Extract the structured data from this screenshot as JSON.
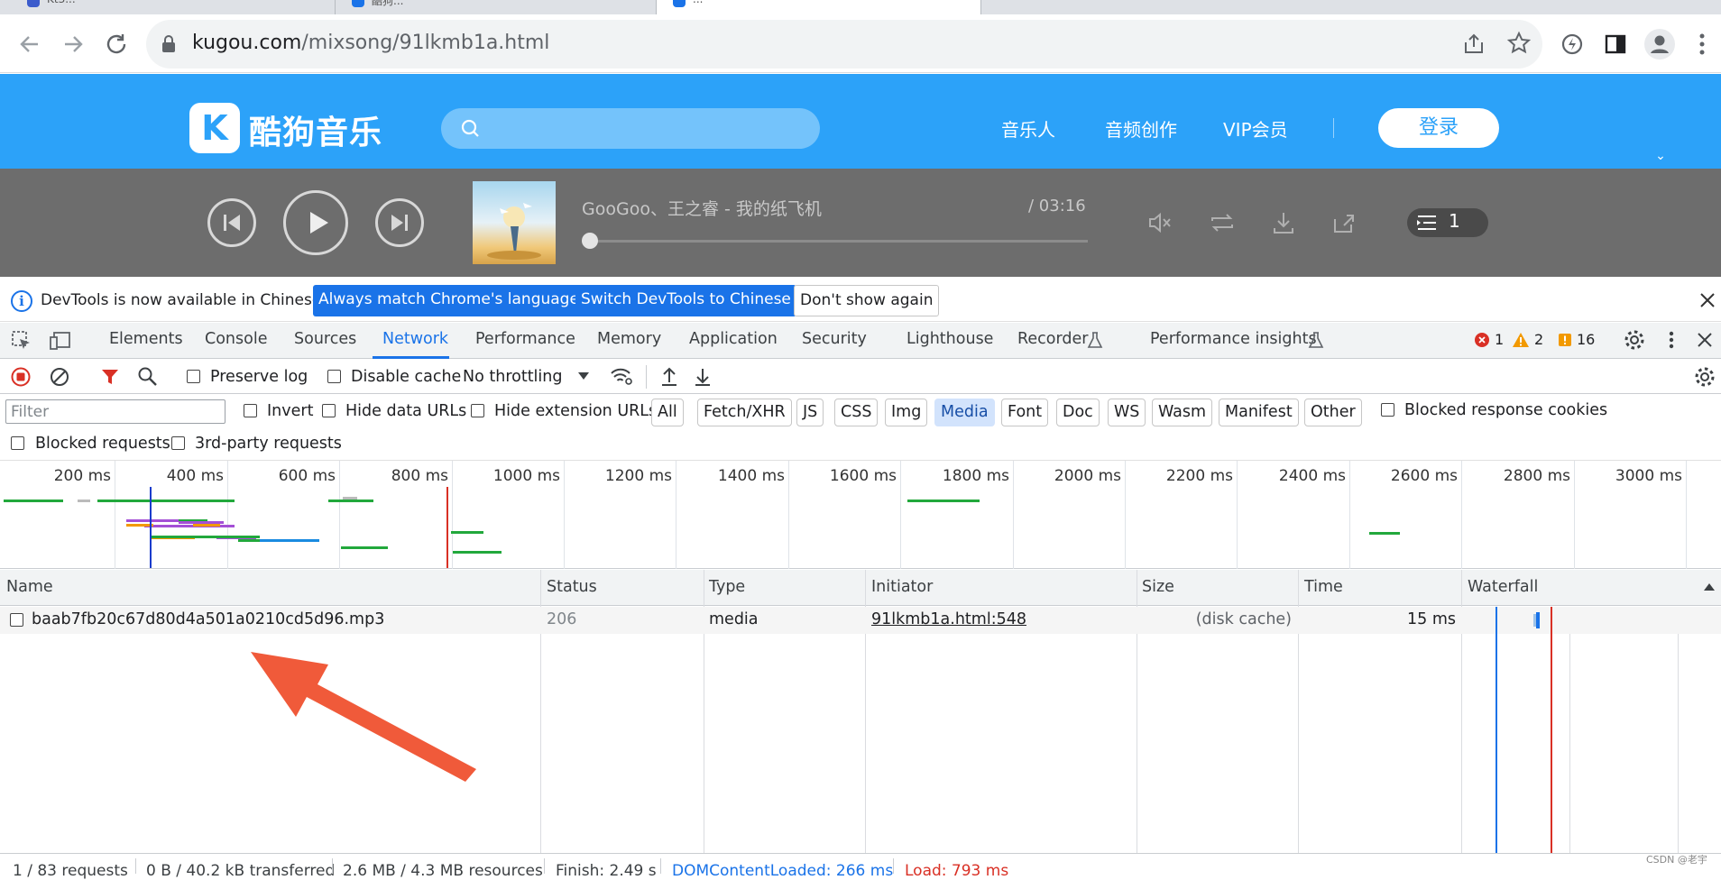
{
  "browser": {
    "tabs": [
      {
        "title": "Kt3...",
        "fav_color": "#3b5bcc"
      },
      {
        "title": "酷狗...",
        "fav_color": "#1a73e8"
      },
      {
        "title": "...",
        "fav_color": "#1a73e8"
      }
    ],
    "url_host": "kugou.com",
    "url_path": "/mixsong/91lkmb1a.html"
  },
  "kugou": {
    "logo_letter": "K",
    "logo_text": "酷狗音乐",
    "nav": [
      "音乐人",
      "音频创作",
      "VIP会员"
    ],
    "login_label": "登录",
    "down_arrow": "⌄"
  },
  "player": {
    "song_title": "GooGoo、王之睿 - 我的纸飞机",
    "time": "/ 03:16",
    "queue_count": "1"
  },
  "infobar": {
    "message": "DevTools is now available in Chinese!",
    "btn_match": "Always match Chrome's language",
    "btn_switch": "Switch DevTools to Chinese",
    "btn_dismiss": "Don't show again"
  },
  "devtools": {
    "tabs": [
      "Elements",
      "Console",
      "Sources",
      "Network",
      "Performance",
      "Memory",
      "Application",
      "Security",
      "Lighthouse",
      "Recorder",
      "Performance insights"
    ],
    "active_tab": "Network",
    "errors": "1",
    "warnings": "2",
    "issues": "16"
  },
  "network_toolbar": {
    "preserve_log": "Preserve log",
    "disable_cache": "Disable cache",
    "throttling": "No throttling"
  },
  "filters": {
    "placeholder": "Filter",
    "invert": "Invert",
    "hide_data_urls": "Hide data URLs",
    "hide_extension_urls": "Hide extension URLs",
    "types": [
      "All",
      "Fetch/XHR",
      "JS",
      "CSS",
      "Img",
      "Media",
      "Font",
      "Doc",
      "WS",
      "Wasm",
      "Manifest",
      "Other"
    ],
    "active_type": "Media",
    "blocked_response_cookies": "Blocked response cookies",
    "blocked_requests": "Blocked requests",
    "third_party": "3rd-party requests"
  },
  "overview": {
    "ticks": [
      "200 ms",
      "400 ms",
      "600 ms",
      "800 ms",
      "1000 ms",
      "1200 ms",
      "1400 ms",
      "1600 ms",
      "1800 ms",
      "2000 ms",
      "2200 ms",
      "2400 ms",
      "2600 ms",
      "2800 ms",
      "3000 ms"
    ]
  },
  "table": {
    "columns": [
      "Name",
      "Status",
      "Type",
      "Initiator",
      "Size",
      "Time",
      "Waterfall"
    ],
    "rows": [
      {
        "name": "baab7fb20c67d80d4a501a0210cd5d96.mp3",
        "status": "206",
        "type": "media",
        "initiator": "91lkmb1a.html:548",
        "size": "(disk cache)",
        "time": "15 ms"
      }
    ]
  },
  "status_bar": {
    "requests": "1 / 83 requests",
    "transferred": "0 B / 40.2 kB transferred",
    "resources": "2.6 MB / 4.3 MB resources",
    "finish": "Finish: 2.49 s",
    "dom_loaded": "DOMContentLoaded: 266 ms",
    "load": "Load: 793 ms"
  },
  "watermark": "CSDN @老宇",
  "colors": {
    "kugou_blue": "#2ca2f9",
    "devtools_blue": "#1a73e8",
    "annotation_arrow": "#f05a3a"
  }
}
